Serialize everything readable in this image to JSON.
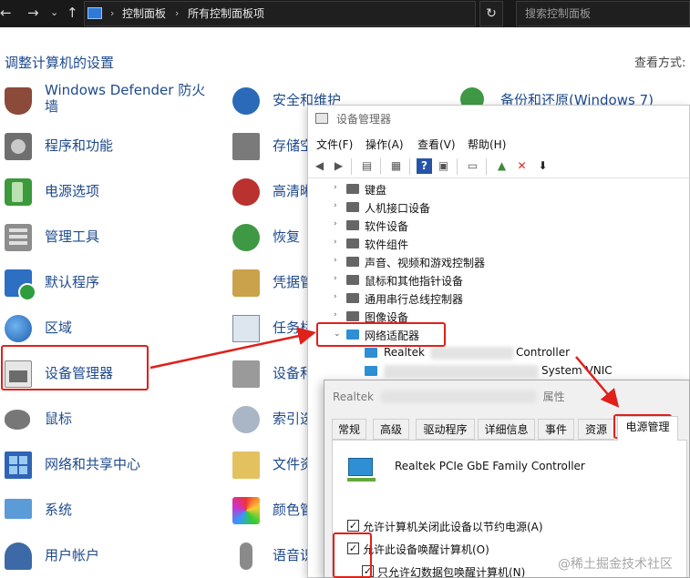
{
  "address_bar": {
    "breadcrumb": [
      "控制面板",
      "所有控制面板项"
    ],
    "search_placeholder": "搜索控制面板",
    "icons": [
      "back-arrow-icon",
      "forward-arrow-icon",
      "dropdown-icon",
      "up-arrow-icon",
      "control-panel-icon",
      "refresh-icon"
    ]
  },
  "control_panel": {
    "heading": "调整计算机的设置",
    "view_by_label": "查看方式:",
    "column1": [
      {
        "label": "Windows Defender 防火墙",
        "icon": "firewall-icon"
      },
      {
        "label": "程序和功能",
        "icon": "programs-icon"
      },
      {
        "label": "电源选项",
        "icon": "power-icon"
      },
      {
        "label": "管理工具",
        "icon": "admin-tools-icon"
      },
      {
        "label": "默认程序",
        "icon": "default-programs-icon"
      },
      {
        "label": "区域",
        "icon": "region-globe-icon"
      },
      {
        "label": "设备管理器",
        "icon": "device-manager-icon"
      },
      {
        "label": "鼠标",
        "icon": "mouse-icon"
      },
      {
        "label": "网络和共享中心",
        "icon": "network-center-icon"
      },
      {
        "label": "系统",
        "icon": "system-icon"
      },
      {
        "label": "用户帐户",
        "icon": "user-accounts-icon"
      }
    ],
    "column2": [
      {
        "label": "安全和维护",
        "icon": "security-flag-icon"
      },
      {
        "label": "存储空",
        "icon": "storage-icon"
      },
      {
        "label": "高清晰",
        "icon": "audio-icon"
      },
      {
        "label": "恢复",
        "icon": "recovery-icon"
      },
      {
        "label": "凭据管",
        "icon": "credentials-icon"
      },
      {
        "label": "任务栏",
        "icon": "taskbar-icon"
      },
      {
        "label": "设备和",
        "icon": "devices-printers-icon"
      },
      {
        "label": "索引选",
        "icon": "indexing-icon"
      },
      {
        "label": "文件资",
        "icon": "file-explorer-icon"
      },
      {
        "label": "颜色管",
        "icon": "color-icon"
      },
      {
        "label": "语音识",
        "icon": "speech-icon"
      }
    ],
    "column3": [
      {
        "label": "备份和还原(Windows 7)",
        "icon": "backup-icon"
      }
    ]
  },
  "device_manager": {
    "title": "设备管理器",
    "menu": [
      "文件(F)",
      "操作(A)",
      "查看(V)",
      "帮助(H)"
    ],
    "toolbar_icons": [
      "back-icon",
      "forward-icon",
      "properties-icon",
      "view-icon",
      "help-icon",
      "view-toggle-icon",
      "monitor-icon",
      "update-driver-icon",
      "uninstall-x-icon",
      "download-icon"
    ],
    "tree": [
      {
        "label": "键盘",
        "expanded": false
      },
      {
        "label": "人机接口设备",
        "expanded": false
      },
      {
        "label": "软件设备",
        "expanded": false
      },
      {
        "label": "软件组件",
        "expanded": false
      },
      {
        "label": "声音、视频和游戏控制器",
        "expanded": false
      },
      {
        "label": "鼠标和其他指针设备",
        "expanded": false
      },
      {
        "label": "通用串行总线控制器",
        "expanded": false
      },
      {
        "label": "图像设备",
        "expanded": false
      },
      {
        "label": "网络适配器",
        "expanded": true
      }
    ],
    "adapters": [
      {
        "prefix": "Realtek",
        "suffix": "Controller"
      },
      {
        "prefix": "",
        "suffix": "System VNIC"
      }
    ]
  },
  "properties_dialog": {
    "title_prefix": "Realtek",
    "title_suffix": "属性",
    "tabs": [
      "常规",
      "高级",
      "驱动程序",
      "详细信息",
      "事件",
      "资源",
      "电源管理"
    ],
    "active_tab": "电源管理",
    "device_name": "Realtek PCIe GbE Family Controller",
    "options": [
      {
        "label": "允许计算机关闭此设备以节约电源(A)",
        "checked": true
      },
      {
        "label": "允许此设备唤醒计算机(O)",
        "checked": true
      },
      {
        "label": "只允许幻数据包唤醒计算机(N)",
        "checked": true
      }
    ]
  },
  "annotations": {
    "highlight_color": "#e0201b",
    "watermark": "@稀土掘金技术社区"
  }
}
